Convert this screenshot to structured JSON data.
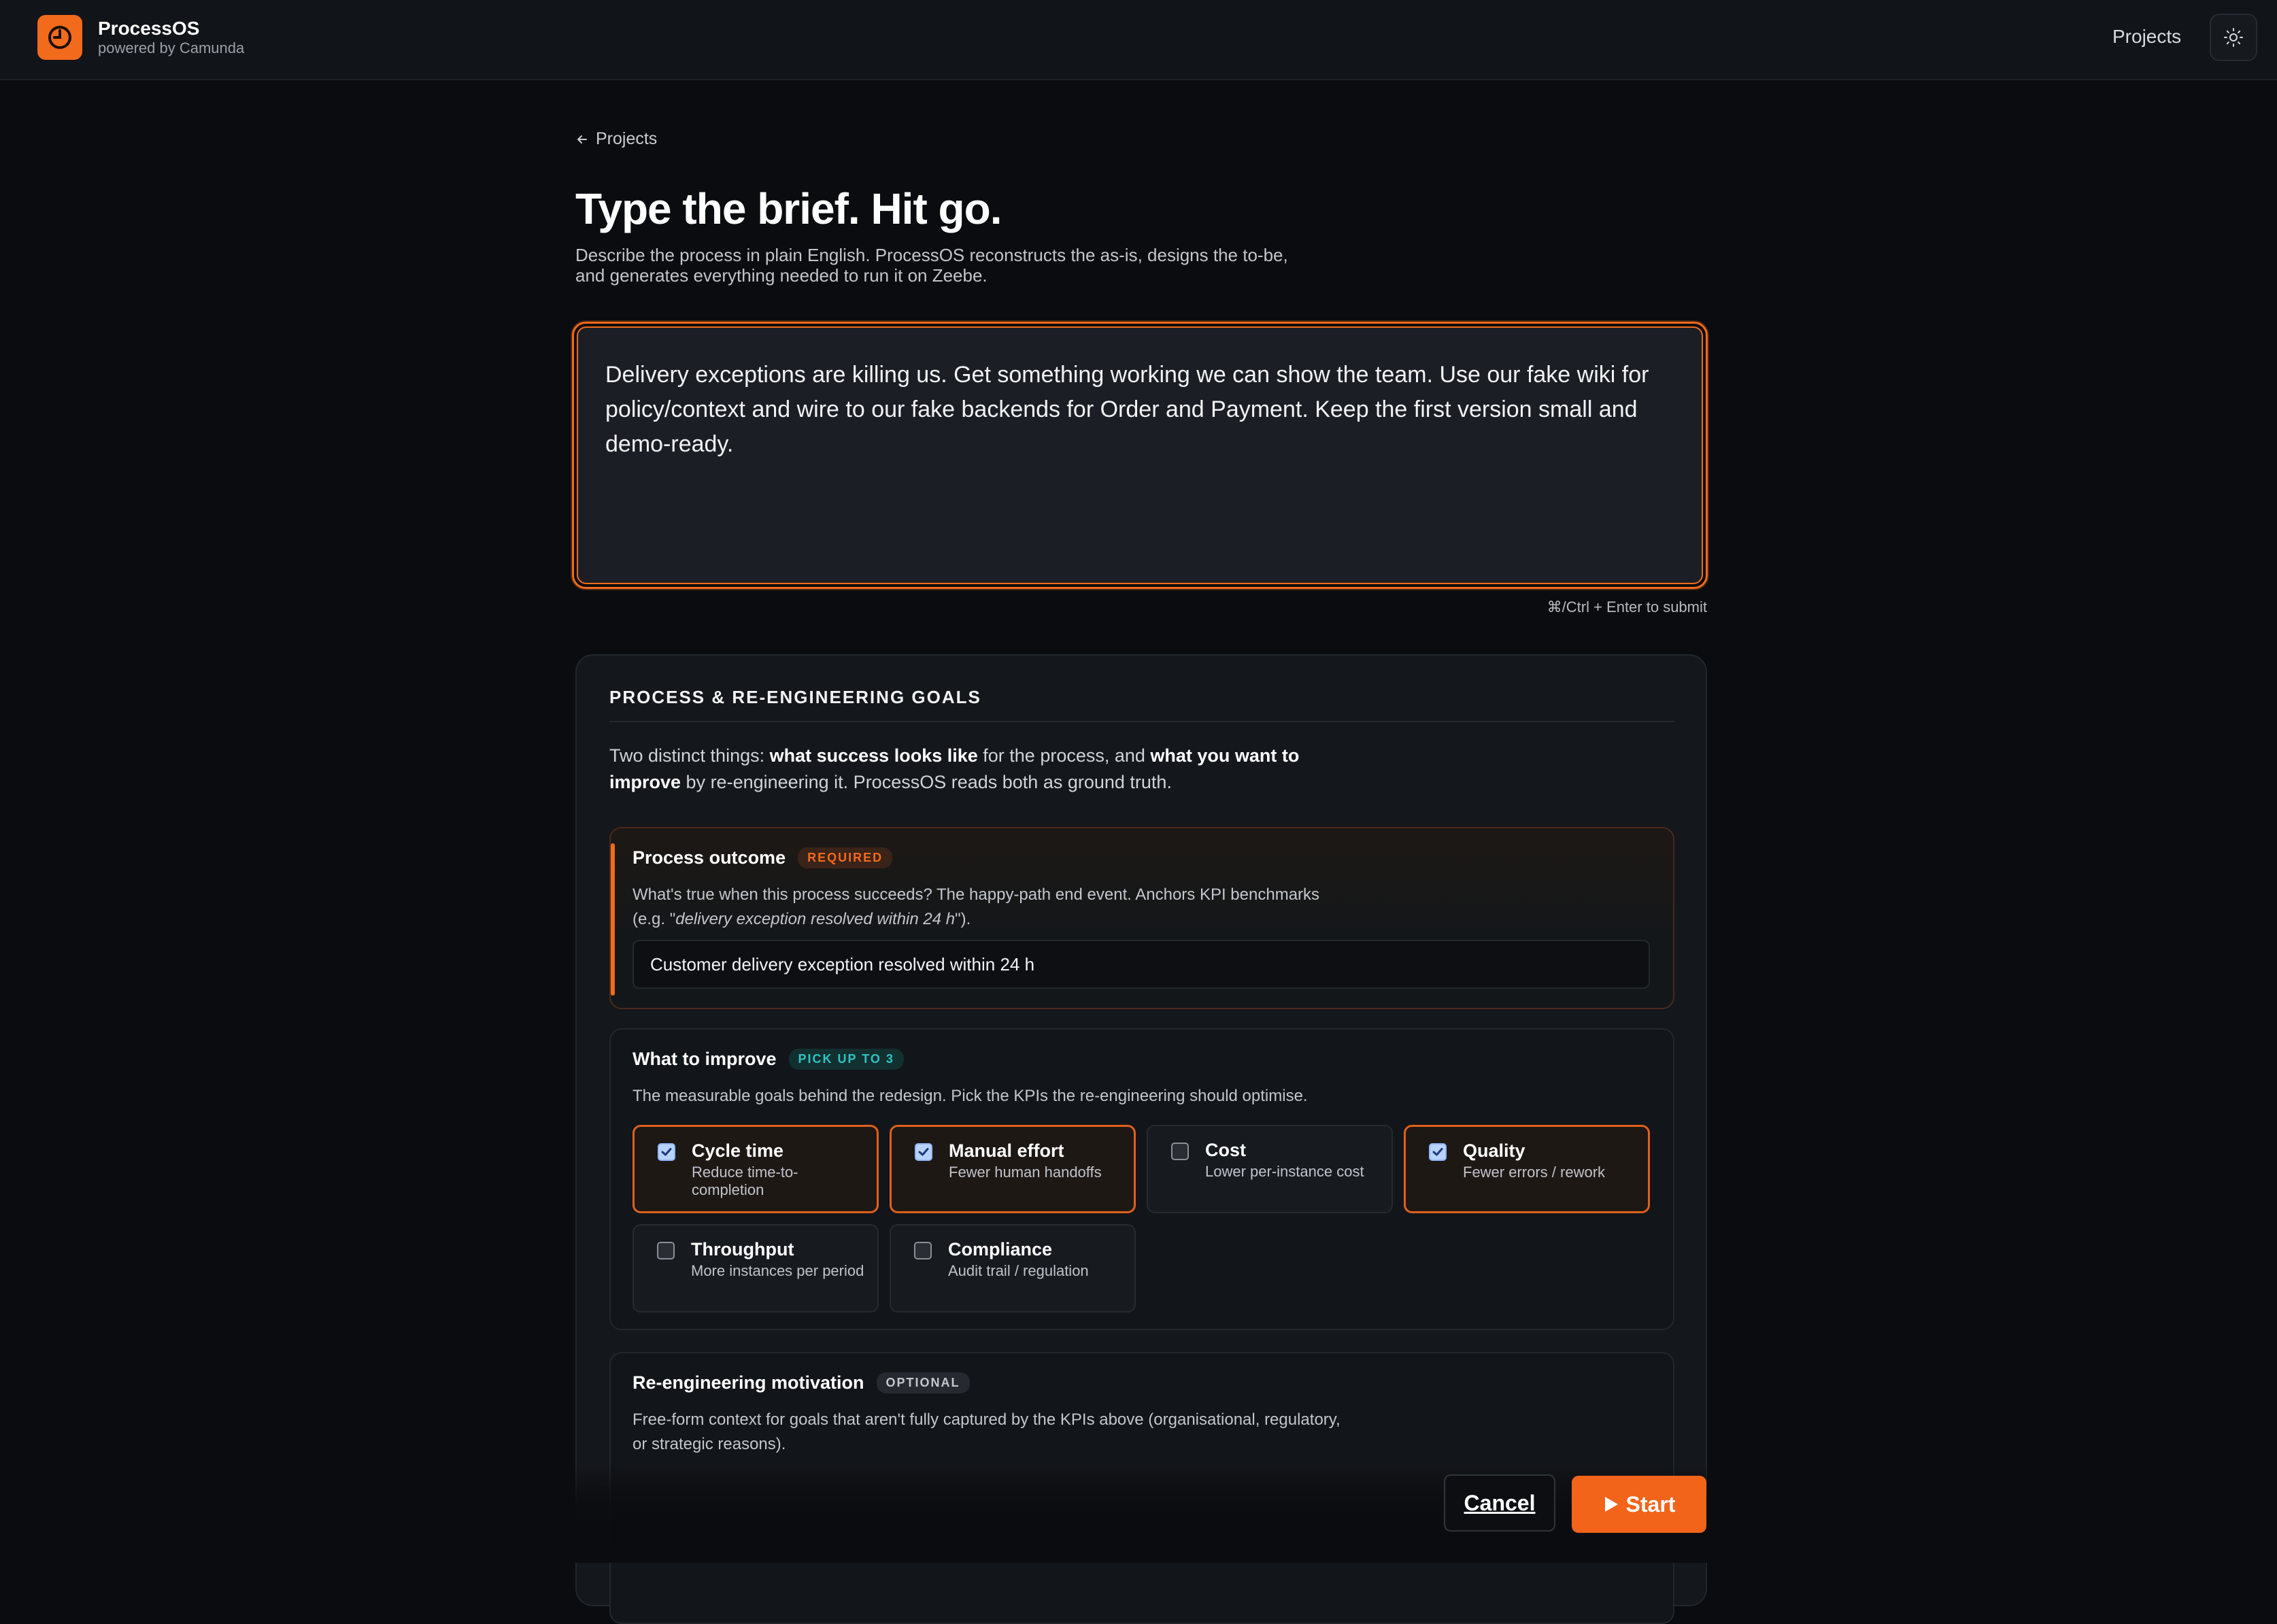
{
  "header": {
    "brand_name": "ProcessOS",
    "brand_sub": "powered by Camunda",
    "nav_projects": "Projects",
    "theme_icon": "sun-icon"
  },
  "breadcrumb": {
    "label": "Projects",
    "icon": "arrow-left-icon"
  },
  "page": {
    "title": "Type the brief. Hit go.",
    "description_line1": "Describe the process in plain English. ProcessOS reconstructs the as-is, designs the to-be,",
    "description_line2": "and generates everything needed to run it on Zeebe."
  },
  "brief": {
    "value": "Delivery exceptions are killing us. Get something working we can show the team. Use our fake wiki for policy/context and wire to our fake backends for Order and Payment. Keep the first version small and demo-ready.",
    "submit_hint": "⌘/Ctrl + Enter to submit"
  },
  "goals": {
    "title": "PROCESS & RE-ENGINEERING GOALS",
    "intro_a": "Two distinct things: ",
    "intro_b": "what success looks like",
    "intro_c": " for the process, and ",
    "intro_d": "what you want to improve",
    "intro_e": " by re-engineering it. ProcessOS reads both as ground truth.",
    "outcome": {
      "title": "Process outcome",
      "badge": "REQUIRED",
      "desc_a": "What's true when this process succeeds? The happy-path end event. Anchors KPI benchmarks",
      "desc_b": "(e.g. \"",
      "desc_c": "delivery exception resolved within 24 h",
      "desc_d": "\").",
      "value": "Customer delivery exception resolved within 24 h"
    },
    "improve": {
      "title": "What to improve",
      "badge": "PICK UP TO 3",
      "desc": "The measurable goals behind the redesign. Pick the KPIs the re-engineering should optimise.",
      "options": [
        {
          "label": "Cycle time",
          "sub": "Reduce time-to-completion",
          "checked": true
        },
        {
          "label": "Manual effort",
          "sub": "Fewer human handoffs",
          "checked": true
        },
        {
          "label": "Cost",
          "sub": "Lower per-instance cost",
          "checked": false
        },
        {
          "label": "Quality",
          "sub": "Fewer errors / rework",
          "checked": true
        },
        {
          "label": "Throughput",
          "sub": "More instances per period",
          "checked": false
        },
        {
          "label": "Compliance",
          "sub": "Audit trail / regulation",
          "checked": false
        }
      ]
    },
    "motivation": {
      "title": "Re-engineering motivation",
      "badge": "OPTIONAL",
      "desc_line1": "Free-form context for goals that aren't fully captured by the KPIs above (organisational, regulatory,",
      "desc_line2": "or strategic reasons)."
    }
  },
  "actions": {
    "cancel": "Cancel",
    "start": "Start"
  },
  "colors": {
    "accent": "#f26a1c",
    "background": "#0a0c0f",
    "panel": "#14171c"
  }
}
